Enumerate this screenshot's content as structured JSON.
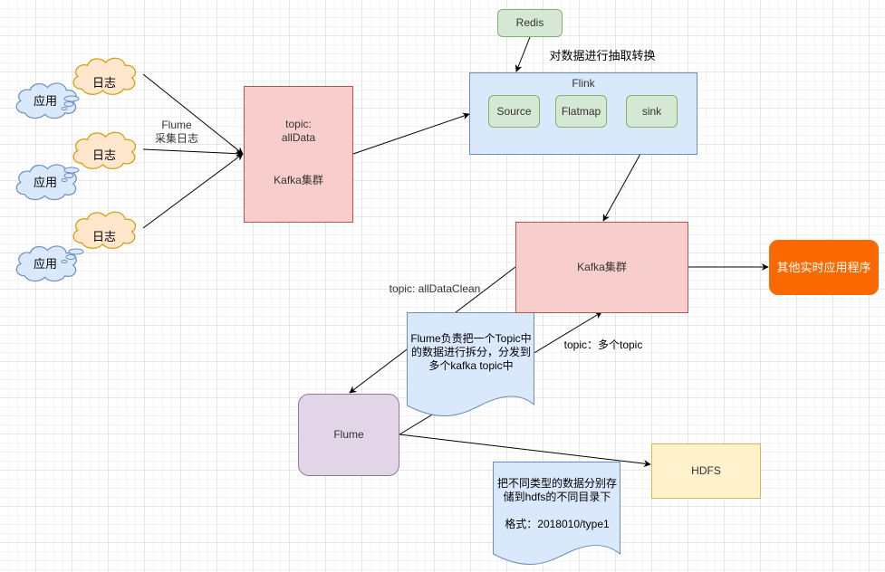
{
  "diagram": {
    "apps": [
      {
        "label": "应用"
      },
      {
        "label": "应用"
      },
      {
        "label": "应用"
      }
    ],
    "logs": [
      {
        "label": "日志"
      },
      {
        "label": "日志"
      },
      {
        "label": "日志"
      }
    ],
    "flume_collect_label": "Flume\n采集日志",
    "kafka_all": {
      "topic": "topic:\nallData",
      "label": "Kafka集群"
    },
    "redis": {
      "label": "Redis"
    },
    "flink_note": "对数据进行抽取转换",
    "flink": {
      "title": "Flink",
      "steps": [
        {
          "label": "Source"
        },
        {
          "label": "Flatmap"
        },
        {
          "label": "sink"
        }
      ]
    },
    "kafka_clean": {
      "label": "Kafka集群"
    },
    "other_apps": {
      "label": "其他实时应用程序"
    },
    "topic_clean_label": "topic: allDataClean",
    "flume_split_note": "Flume负责把一个Topic中\n的数据进行拆分，分发到\n多个kafka topic中",
    "topic_multi_label": "topic：多个topic",
    "flume": {
      "label": "Flume"
    },
    "hdfs": {
      "label": "HDFS"
    },
    "hdfs_note": "把不同类型的数据分别存\n储到hdfs的不同目录下\n\n格式：2018010/type1"
  },
  "colors": {
    "app_fill": "#dae8fc",
    "app_stroke": "#6c8ebf",
    "log_fill": "#ffe6cc",
    "log_stroke": "#d79b00",
    "kafka_fill": "#f8cecc",
    "kafka_stroke": "#b85450",
    "flink_fill": "#dae8fc",
    "flink_stroke": "#6c8ebf",
    "step_fill": "#d5e8d4",
    "step_stroke": "#82b366",
    "flume_fill": "#e1d5e7",
    "flume_stroke": "#9673a6",
    "hdfs_fill": "#fff2cc",
    "hdfs_stroke": "#d6b656",
    "accent_orange": "#fa6800"
  }
}
